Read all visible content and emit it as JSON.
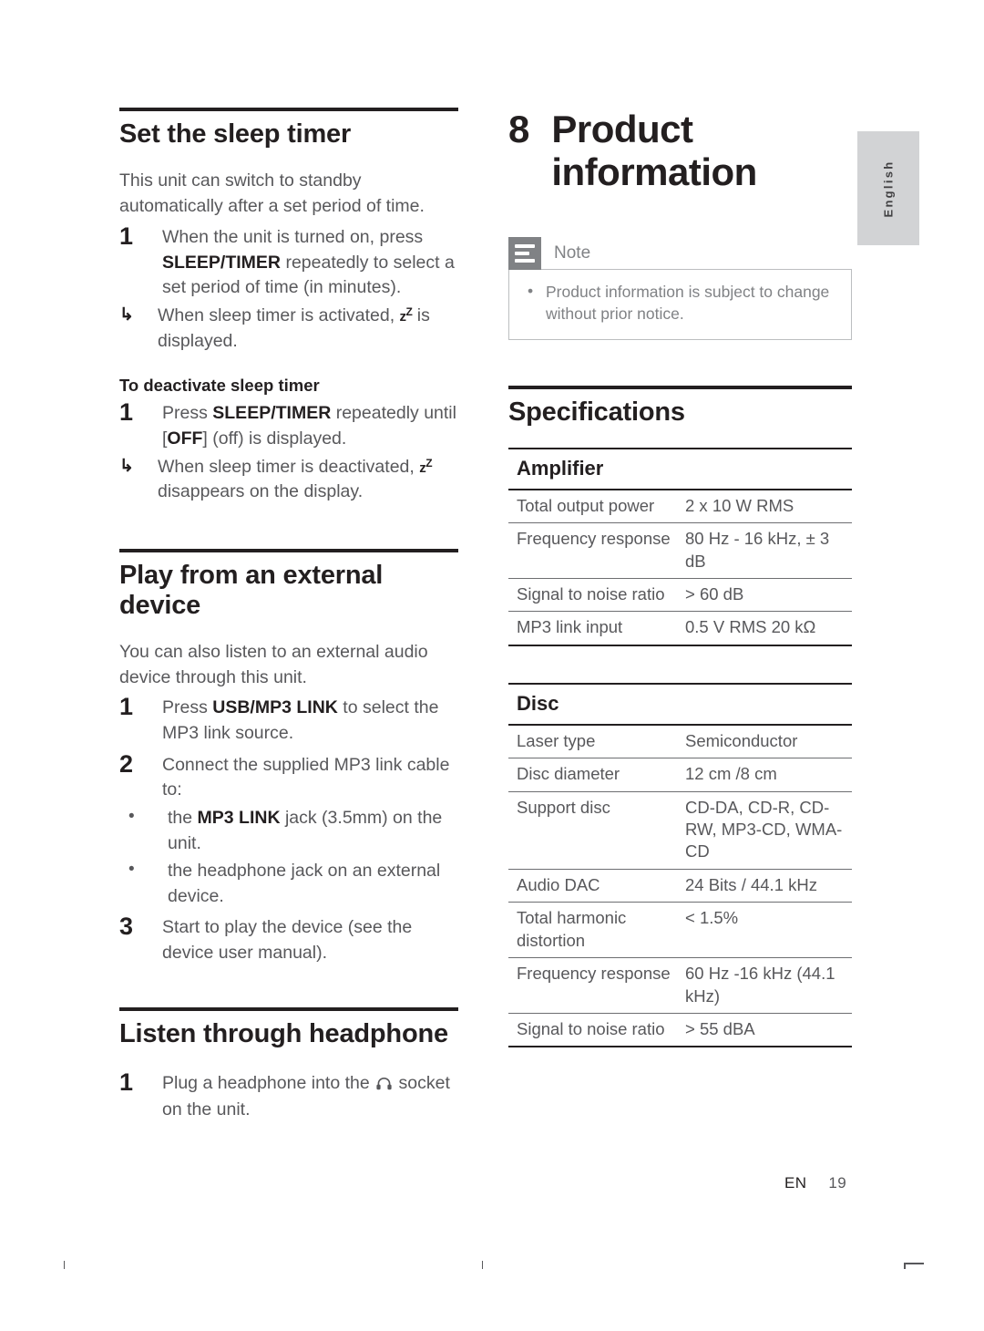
{
  "footer": {
    "lang_code": "EN",
    "page_number": "19"
  },
  "language_tab": {
    "label": "English"
  },
  "left_column": {
    "section_sleep_timer": {
      "heading": "Set the sleep timer",
      "intro": "This unit can switch to standby automatically after a set period of time.",
      "step1_num": "1",
      "step1_a": "When the unit is turned on, press ",
      "step1_bold": "SLEEP/TIMER",
      "step1_b": " repeatedly to select a set period of time (in minutes).",
      "arrow_glyph": "↳",
      "arrow1_a": "When sleep timer is activated, ",
      "arrow1_zz_base": "z",
      "arrow1_zz_sup": "Z",
      "arrow1_b": " is displayed.",
      "subhead": "To deactivate sleep timer",
      "step2_num": "1",
      "step2_a": "Press ",
      "step2_bold": "SLEEP/TIMER",
      "step2_b": " repeatedly until [",
      "step2_bold2": "OFF",
      "step2_c": "] (off) is displayed.",
      "arrow2_a": "When sleep timer is deactivated, ",
      "arrow2_zz_base": "z",
      "arrow2_zz_sup": "Z",
      "arrow2_b": " disappears on the display."
    },
    "section_external_device": {
      "heading": "Play from an external device",
      "intro": "You can also listen to an external audio device through this unit.",
      "step1_num": "1",
      "step1_a": "Press ",
      "step1_bold": "USB/MP3 LINK",
      "step1_b": " to select the MP3 link source.",
      "step2_num": "2",
      "step2_text": "Connect the supplied MP3 link cable to:",
      "bullet_glyph": "•",
      "bullet1_a": "the ",
      "bullet1_bold": "MP3 LINK",
      "bullet1_b": " jack (3.5mm) on the unit.",
      "bullet2": "the headphone jack on an external device.",
      "step3_num": "3",
      "step3_text": "Start to play the device (see the device user manual)."
    },
    "section_headphone": {
      "heading": "Listen through headphone",
      "step1_num": "1",
      "step1_a": "Plug a headphone into the ",
      "step1_icon": "headphone-icon",
      "step1_b": " socket on the unit."
    }
  },
  "right_column": {
    "chapter": {
      "number": "8",
      "title": "Product information"
    },
    "note": {
      "icon": "note-icon",
      "title": "Note",
      "bullet_glyph": "•",
      "items": [
        "Product information is subject to change without prior notice."
      ]
    },
    "specifications": {
      "heading": "Specifications",
      "blocks": [
        {
          "title": "Amplifier",
          "rows": [
            {
              "key": "Total output power",
              "value": "2 x 10 W RMS"
            },
            {
              "key": "Frequency response",
              "value": "80 Hz - 16 kHz, ± 3 dB"
            },
            {
              "key": "Signal to noise ratio",
              "value": "> 60 dB"
            },
            {
              "key": "MP3 link input",
              "value": "0.5 V RMS 20 kΩ"
            }
          ]
        },
        {
          "title": "Disc",
          "rows": [
            {
              "key": "Laser type",
              "value": "Semiconductor"
            },
            {
              "key": "Disc diameter",
              "value": "12 cm /8 cm"
            },
            {
              "key": "Support disc",
              "value": "CD-DA, CD-R, CD-RW, MP3-CD, WMA-CD"
            },
            {
              "key": "Audio DAC",
              "value": "24 Bits / 44.1 kHz"
            },
            {
              "key": "Total harmonic distortion",
              "value": "< 1.5%"
            },
            {
              "key": "Frequency response",
              "value": "60 Hz -16 kHz (44.1 kHz)"
            },
            {
              "key": "Signal to noise ratio",
              "value": "> 55 dBA"
            }
          ]
        }
      ]
    }
  }
}
